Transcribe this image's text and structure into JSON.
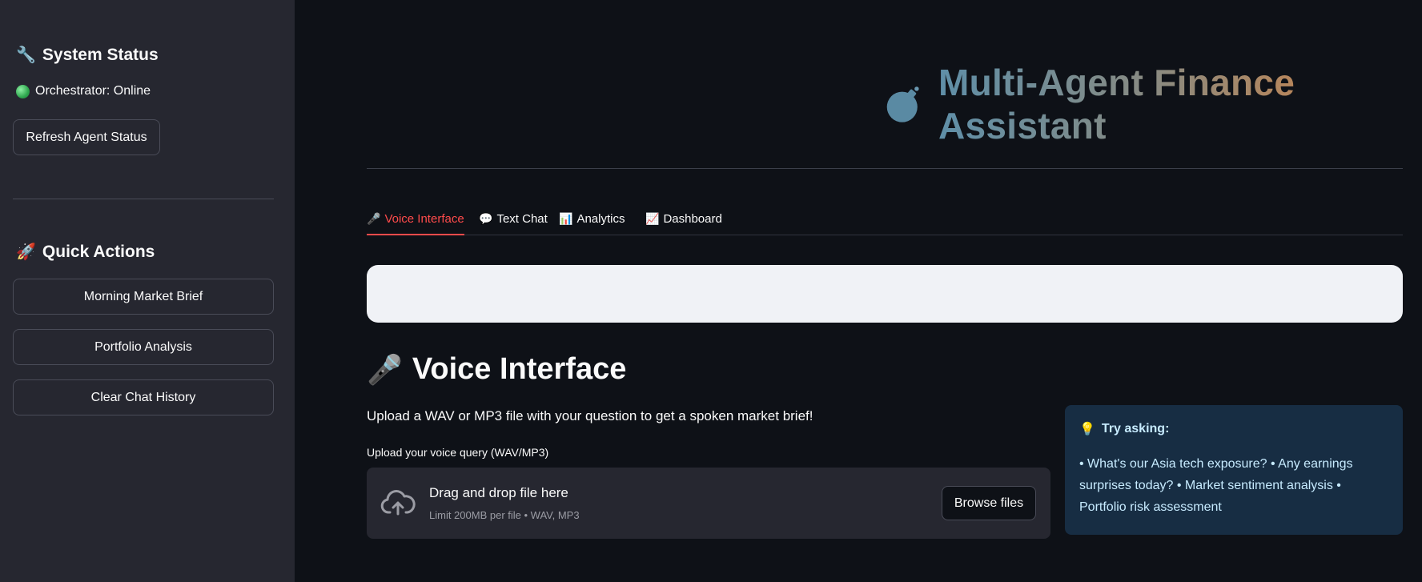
{
  "sidebar": {
    "system_status": {
      "icon": "🔧",
      "title": "System Status"
    },
    "orchestrator_status": "Orchestrator: Online",
    "refresh_button": "Refresh Agent Status",
    "quick_actions": {
      "icon": "🚀",
      "title": "Quick Actions"
    },
    "actions": [
      {
        "label": "Morning Market Brief"
      },
      {
        "label": "Portfolio Analysis"
      },
      {
        "label": "Clear Chat History"
      }
    ]
  },
  "header": {
    "title": "Multi-Agent Finance Assistant"
  },
  "tabs": [
    {
      "icon": "🎤",
      "label": "Voice Interface",
      "active": true
    },
    {
      "icon": "💬",
      "label": "Text Chat",
      "active": false
    },
    {
      "icon": "📊",
      "label": "Analytics",
      "active": false
    },
    {
      "icon": "📈",
      "label": "Dashboard",
      "active": false
    }
  ],
  "voice": {
    "icon": "🎤",
    "title": "Voice Interface",
    "description": "Upload a WAV or MP3 file with your question to get a spoken market brief!",
    "upload_label": "Upload your voice query (WAV/MP3)",
    "dropzone_title": "Drag and drop file here",
    "dropzone_limit": "Limit 200MB per file • WAV, MP3",
    "browse_button": "Browse files"
  },
  "tips": {
    "icon": "💡",
    "title": "Try asking:",
    "body": "• What's our Asia tech exposure? • Any earnings surprises today? • Market sentiment analysis • Portfolio risk assessment"
  },
  "colors": {
    "accent": "#ff4b4b",
    "background": "#0e1117",
    "sidebar": "#262730",
    "tip_background": "#172d43",
    "status_online": "#2fa84f"
  }
}
